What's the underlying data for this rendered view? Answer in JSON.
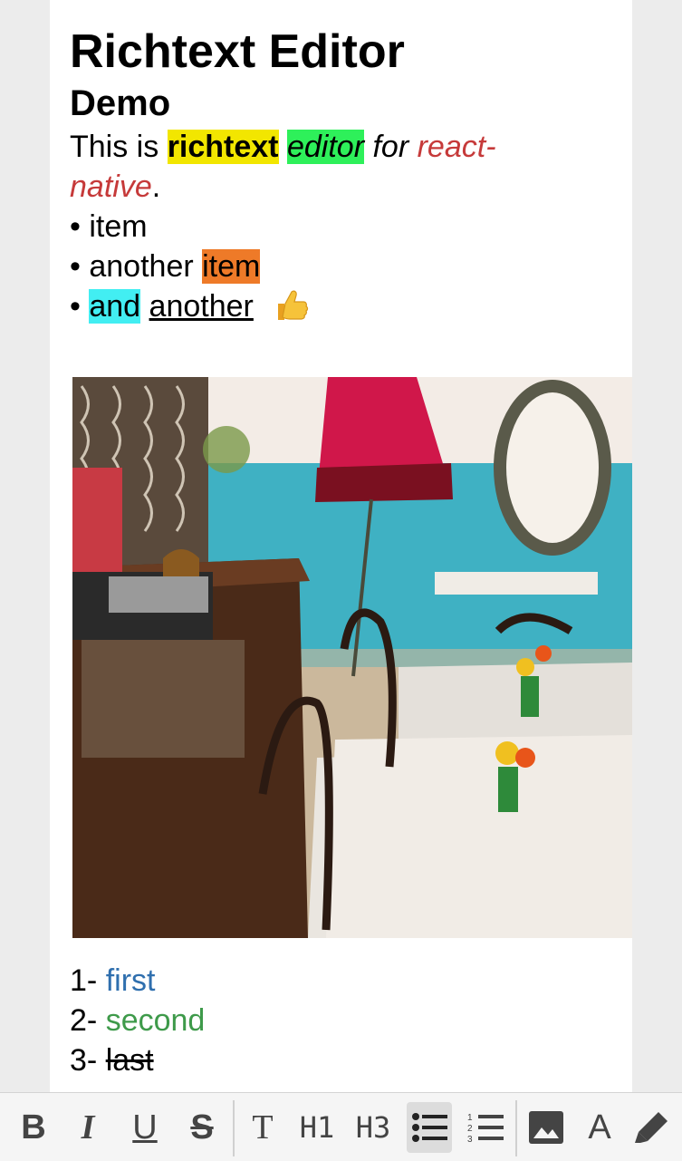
{
  "editor": {
    "title": "Richtext Editor",
    "subtitle": "Demo",
    "intro": {
      "this_is": "This is ",
      "richtext": "richtext",
      "editor": "editor",
      "for": " for ",
      "react": "react-",
      "native": "native",
      "period": "."
    },
    "bullets": {
      "marker": "•",
      "item1": "item",
      "item2_text": "another ",
      "item2_hl": "item",
      "item3_hl": "and",
      "item3_ul": "another"
    },
    "numbered": {
      "one_num": "1-",
      "one_text": "first",
      "two_num": "2-",
      "two_text": "second",
      "three_num": "3-",
      "three_text": "last"
    }
  },
  "toolbar": {
    "bold": "B",
    "italic": "I",
    "underline": "U",
    "strike": "S",
    "text": "T",
    "h1": "H1",
    "h3": "H3",
    "font": "A"
  },
  "colors": {
    "yellow_highlight": "#f2e600",
    "green_highlight": "#2ef05a",
    "orange_highlight": "#ee7a28",
    "cyan_highlight": "#42eef2",
    "red_text": "#c63a3a",
    "blue_text": "#2f6fae",
    "green_text": "#3e9a4a"
  }
}
